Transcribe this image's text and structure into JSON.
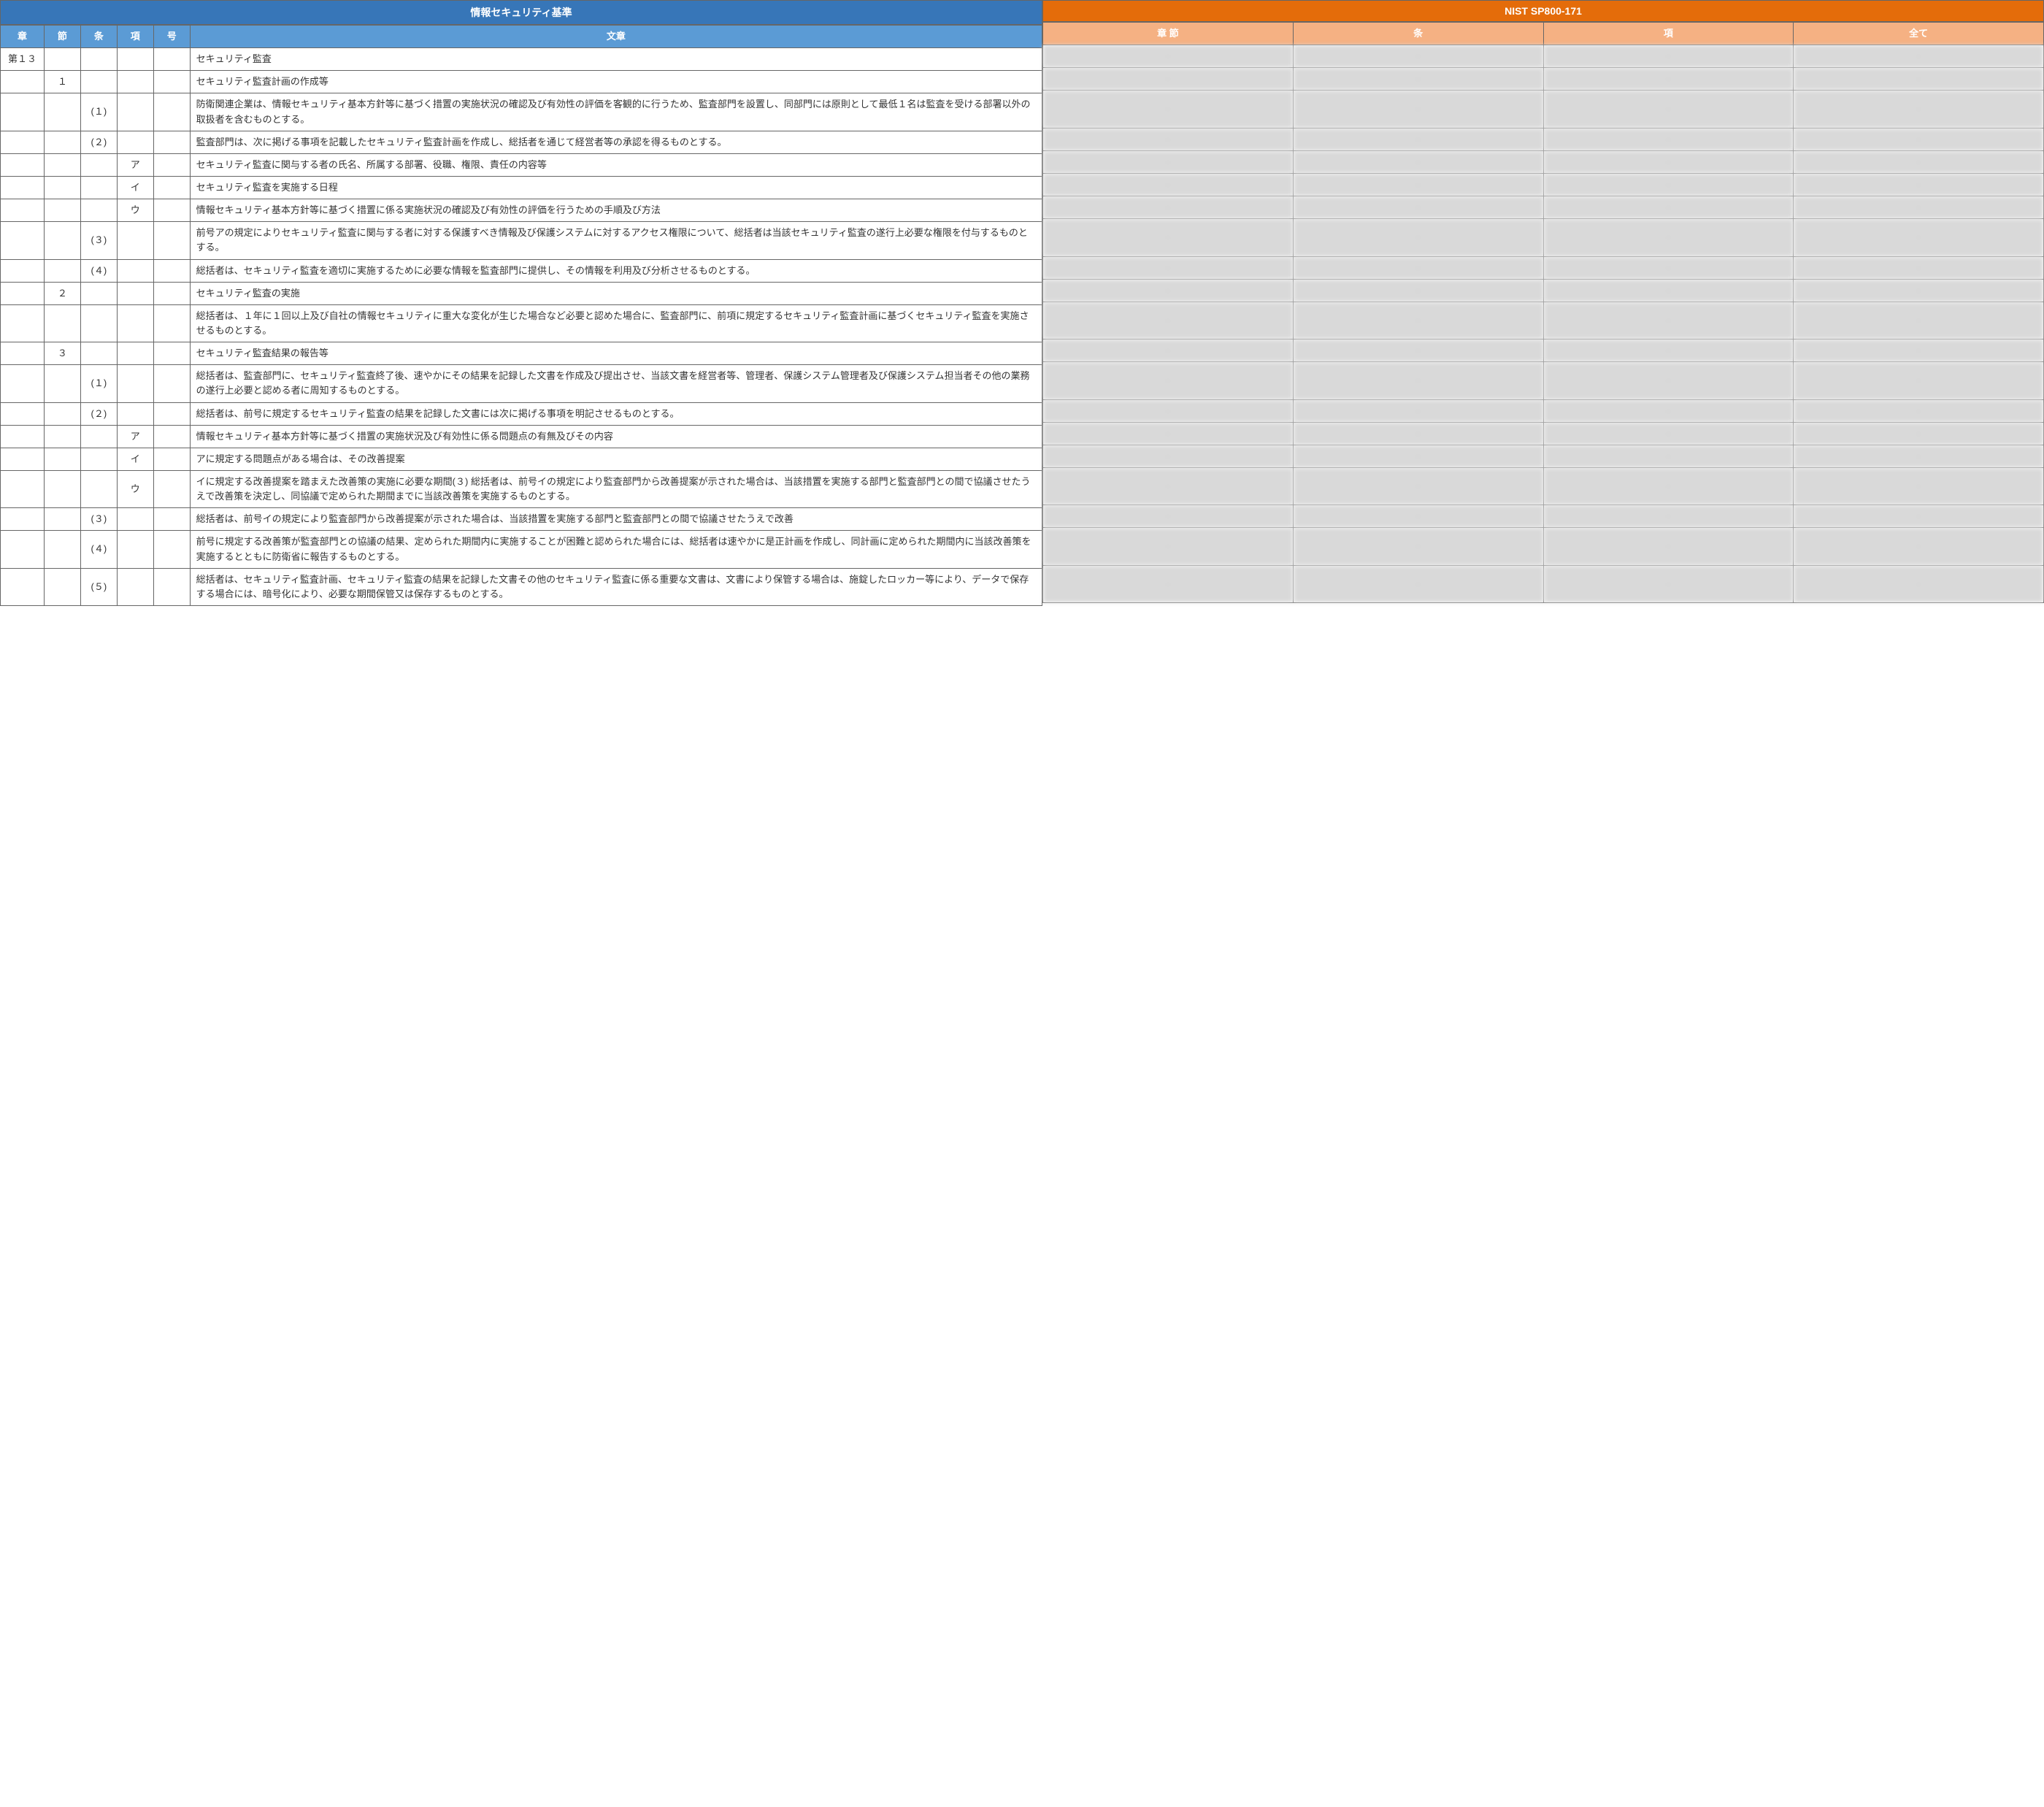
{
  "left": {
    "title": "情報セキュリティ基準",
    "headers": {
      "chapter": "章",
      "section": "節",
      "article": "条",
      "paragraph": "項",
      "item": "号",
      "text": "文章"
    },
    "rows": [
      {
        "chapter": "第１３",
        "section": "",
        "article": "",
        "paragraph": "",
        "item": "",
        "text": "セキュリティ監査"
      },
      {
        "chapter": "",
        "section": "１",
        "article": "",
        "paragraph": "",
        "item": "",
        "text": "セキュリティ監査計画の作成等"
      },
      {
        "chapter": "",
        "section": "",
        "article": "(１)",
        "paragraph": "",
        "item": "",
        "text": "防衛関連企業は、情報セキュリティ基本方針等に基づく措置の実施状況の確認及び有効性の評価を客観的に行うため、監査部門を設置し、同部門には原則として最低１名は監査を受ける部署以外の取扱者を含むものとする。"
      },
      {
        "chapter": "",
        "section": "",
        "article": "(２)",
        "paragraph": "",
        "item": "",
        "text": "監査部門は、次に掲げる事項を記載したセキュリティ監査計画を作成し、総括者を通じて経営者等の承認を得るものとする。"
      },
      {
        "chapter": "",
        "section": "",
        "article": "",
        "paragraph": "ア",
        "item": "",
        "text": "セキュリティ監査に関与する者の氏名、所属する部署、役職、権限、責任の内容等"
      },
      {
        "chapter": "",
        "section": "",
        "article": "",
        "paragraph": "イ",
        "item": "",
        "text": "セキュリティ監査を実施する日程"
      },
      {
        "chapter": "",
        "section": "",
        "article": "",
        "paragraph": "ウ",
        "item": "",
        "text": "情報セキュリティ基本方針等に基づく措置に係る実施状況の確認及び有効性の評価を行うための手順及び方法"
      },
      {
        "chapter": "",
        "section": "",
        "article": "(３)",
        "paragraph": "",
        "item": "",
        "text": "前号アの規定によりセキュリティ監査に関与する者に対する保護すべき情報及び保護システムに対するアクセス権限について、総括者は当該セキュリティ監査の遂行上必要な権限を付与するものとする。"
      },
      {
        "chapter": "",
        "section": "",
        "article": "(４)",
        "paragraph": "",
        "item": "",
        "text": "総括者は、セキュリティ監査を適切に実施するために必要な情報を監査部門に提供し、その情報を利用及び分析させるものとする。"
      },
      {
        "chapter": "",
        "section": "２",
        "article": "",
        "paragraph": "",
        "item": "",
        "text": "セキュリティ監査の実施"
      },
      {
        "chapter": "",
        "section": "",
        "article": "",
        "paragraph": "",
        "item": "",
        "text": "総括者は、１年に１回以上及び自社の情報セキュリティに重大な変化が生じた場合など必要と認めた場合に、監査部門に、前項に規定するセキュリティ監査計画に基づくセキュリティ監査を実施させるものとする。"
      },
      {
        "chapter": "",
        "section": "３",
        "article": "",
        "paragraph": "",
        "item": "",
        "text": "セキュリティ監査結果の報告等"
      },
      {
        "chapter": "",
        "section": "",
        "article": "(１)",
        "paragraph": "",
        "item": "",
        "text": "総括者は、監査部門に、セキュリティ監査終了後、速やかにその結果を記録した文書を作成及び提出させ、当該文書を経営者等、管理者、保護システム管理者及び保護システム担当者その他の業務の遂行上必要と認める者に周知するものとする。"
      },
      {
        "chapter": "",
        "section": "",
        "article": "(２)",
        "paragraph": "",
        "item": "",
        "text": "総括者は、前号に規定するセキュリティ監査の結果を記録した文書には次に掲げる事項を明記させるものとする。"
      },
      {
        "chapter": "",
        "section": "",
        "article": "",
        "paragraph": "ア",
        "item": "",
        "text": "情報セキュリティ基本方針等に基づく措置の実施状況及び有効性に係る問題点の有無及びその内容"
      },
      {
        "chapter": "",
        "section": "",
        "article": "",
        "paragraph": "イ",
        "item": "",
        "text": "アに規定する問題点がある場合は、その改善提案"
      },
      {
        "chapter": "",
        "section": "",
        "article": "",
        "paragraph": "ウ",
        "item": "",
        "text": "イに規定する改善提案を踏まえた改善策の実施に必要な期間(３) 総括者は、前号イの規定により監査部門から改善提案が示された場合は、当該措置を実施する部門と監査部門との間で協議させたうえで改善策を決定し、同協議で定められた期間までに当該改善策を実施するものとする。"
      },
      {
        "chapter": "",
        "section": "",
        "article": "(３)",
        "paragraph": "",
        "item": "",
        "text": "総括者は、前号イの規定により監査部門から改善提案が示された場合は、当該措置を実施する部門と監査部門との間で協議させたうえで改善"
      },
      {
        "chapter": "",
        "section": "",
        "article": "(４)",
        "paragraph": "",
        "item": "",
        "text": "前号に規定する改善策が監査部門との協議の結果、定められた期間内に実施することが困難と認められた場合には、総括者は速やかに是正計画を作成し、同計画に定められた期間内に当該改善策を実施するとともに防衛省に報告するものとする。"
      },
      {
        "chapter": "",
        "section": "",
        "article": "(５)",
        "paragraph": "",
        "item": "",
        "text": "総括者は、セキュリティ監査計画、セキュリティ監査の結果を記録した文書その他のセキュリティ監査に係る重要な文書は、文書により保管する場合は、施錠したロッカー等により、データで保存する場合には、暗号化により、必要な期間保管又は保存するものとする。"
      }
    ]
  },
  "right": {
    "title": "NIST SP800-171",
    "headers": {
      "chap_sec": "章 節",
      "article": "条",
      "paragraph": "項",
      "all": "全て"
    },
    "rows": [
      {
        "c1": "-",
        "c2": "-",
        "c3": "-",
        "c4": "-"
      },
      {
        "c1": "-",
        "c2": "-",
        "c3": "-",
        "c4": "-"
      },
      {
        "c1": "-",
        "c2": "-",
        "c3": "-",
        "c4": "-"
      },
      {
        "c1": "-",
        "c2": "-",
        "c3": "-",
        "c4": "-"
      },
      {
        "c1": "-",
        "c2": "-",
        "c3": "-",
        "c4": "-"
      },
      {
        "c1": "-",
        "c2": "-",
        "c3": "-",
        "c4": "-"
      },
      {
        "c1": "-",
        "c2": "-",
        "c3": "-",
        "c4": "-"
      },
      {
        "c1": "-",
        "c2": "-",
        "c3": "-",
        "c4": "-"
      },
      {
        "c1": "-",
        "c2": "-",
        "c3": "-",
        "c4": "-"
      },
      {
        "c1": "-",
        "c2": "-",
        "c3": "-",
        "c4": "-"
      },
      {
        "c1": "-",
        "c2": "-",
        "c3": "-",
        "c4": "-"
      },
      {
        "c1": "-",
        "c2": "-",
        "c3": "-",
        "c4": "-"
      },
      {
        "c1": "-",
        "c2": "-",
        "c3": "-",
        "c4": "-"
      },
      {
        "c1": "-",
        "c2": "-",
        "c3": "-",
        "c4": "-"
      },
      {
        "c1": "-",
        "c2": "-",
        "c3": "-",
        "c4": "-"
      },
      {
        "c1": "-",
        "c2": "-",
        "c3": "-",
        "c4": "-"
      },
      {
        "c1": "-",
        "c2": "-",
        "c3": "-",
        "c4": "-"
      },
      {
        "c1": "-",
        "c2": "-",
        "c3": "-",
        "c4": "-"
      },
      {
        "c1": "-",
        "c2": "-",
        "c3": "-",
        "c4": "-"
      },
      {
        "c1": "-",
        "c2": "-",
        "c3": "-",
        "c4": "-"
      }
    ]
  }
}
